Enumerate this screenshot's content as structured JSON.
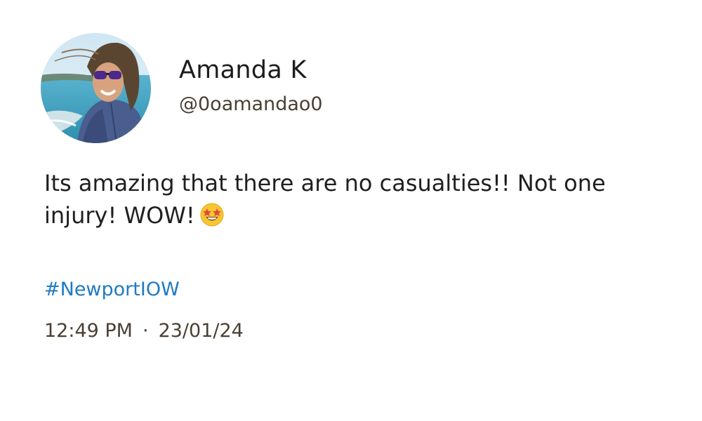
{
  "author": {
    "display_name": "Amanda K",
    "handle": "@0oamandao0",
    "avatar_icon": "profile-photo"
  },
  "post": {
    "text": "Its amazing that there are no casualties!! Not one injury! WOW!",
    "emoji": "star-struck-emoji",
    "hashtag": "#NewportIOW"
  },
  "meta": {
    "time": "12:49 PM",
    "separator": "·",
    "date": "23/01/24"
  },
  "colors": {
    "hashtag": "#1e7bc3",
    "secondary_text": "#4a3f33",
    "primary_text": "#1f1f1f"
  }
}
